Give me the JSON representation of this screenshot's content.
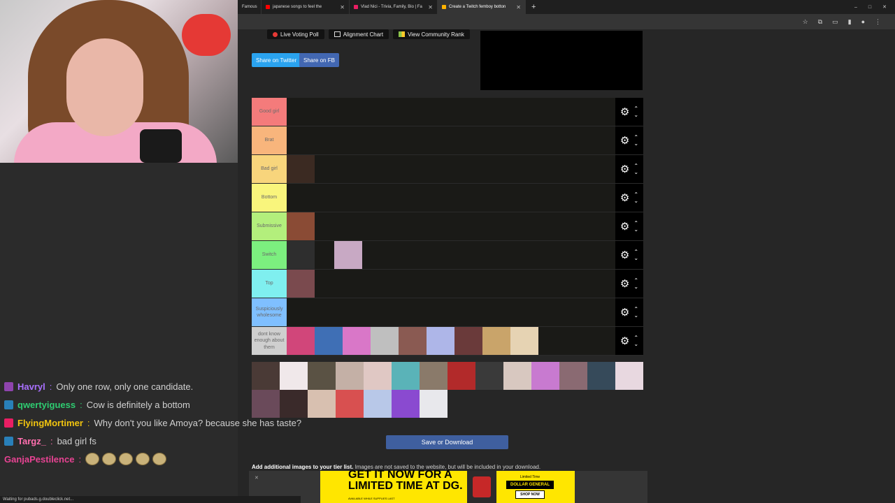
{
  "browser": {
    "tabs": [
      {
        "title": "Famous",
        "color": "#c62828",
        "active": false
      },
      {
        "title": "japanese songs to feel the",
        "color": "#ff0000",
        "active": false
      },
      {
        "title": "Vlad Nici - Trivia, Family, Bio | Fa",
        "color": "#e91e63",
        "active": false
      },
      {
        "title": "Create a Twitch femboy botton",
        "color": "#ffb300",
        "active": true
      }
    ],
    "new_tab": "+",
    "window_controls": [
      "–",
      "□",
      "✕"
    ]
  },
  "toolbar": {
    "live_voting": "Live Voting Poll",
    "alignment_chart": "Alignment Chart",
    "community_rank": "View Community Rank",
    "share_twitter": "Share on Twitter",
    "share_fb": "Share on FB"
  },
  "tiers": [
    {
      "label": "Good girl",
      "color": "#f47b7b",
      "items": []
    },
    {
      "label": "Brat",
      "color": "#f8b57c",
      "items": []
    },
    {
      "label": "Bad girl",
      "color": "#f8d57c",
      "items": [
        "#3b2a22"
      ]
    },
    {
      "label": "Bottom",
      "color": "#f9f57c",
      "items": []
    },
    {
      "label": "Submissive",
      "color": "#b3ef7c",
      "items": [
        "#8a4b35"
      ]
    },
    {
      "label": "Switch",
      "color": "#7cef7f",
      "items": [
        "#2e2e2e"
      ],
      "floating": "#c8a9c4"
    },
    {
      "label": "Top",
      "color": "#7fefef",
      "items": [
        "#7a4a4e"
      ]
    },
    {
      "label": "Suspiciously wholesome",
      "color": "#7fbfff",
      "items": []
    },
    {
      "label": "dont know enough about them",
      "color": "#cfcfcf",
      "items": [
        "#d1467a",
        "#3f6fb5",
        "#d977c8",
        "#bfbfbf",
        "#8a5a52",
        "#aeb6e8",
        "#6a3a3a",
        "#c9a46a",
        "#e6d3b3"
      ]
    }
  ],
  "pool": [
    "#4a3a36",
    "#f0e8ea",
    "#5a5244",
    "#c4b0a6",
    "#e0c8c4",
    "#5ab3b8",
    "#8a7a6a",
    "#b22a2a",
    "#3a3a3a",
    "#d8c8c0",
    "#c87ad0",
    "#8a6a72",
    "#364a5a",
    "#e8d8e0",
    "#6a4a5a",
    "#3a2a2a",
    "#d8c0b0",
    "#d85050",
    "#b8c8e8",
    "#8a4ad0",
    "#e8e8ec"
  ],
  "save_button": "Save or Download",
  "add_images": {
    "bold": "Add additional images to your tier list.",
    "rest": " Images are not saved to the website, but will be included in your download."
  },
  "ad": {
    "headline": "GET IT NOW FOR A LIMITED TIME AT DG.",
    "fine_print": "AVAILABLE WHILE SUPPLIES LAST",
    "limited": "Limited Time",
    "brand": "DOLLAR GENERAL",
    "shop": "SHOP NOW"
  },
  "chat": [
    {
      "user": "Havryl",
      "text": "Only one row, only one candidate.",
      "color": "#a970ff",
      "badge": "#8e44ad"
    },
    {
      "user": "qwertyiguess",
      "text": "Cow is definitely a bottom",
      "color": "#2ecc71",
      "badge": "#2980b9"
    },
    {
      "user": "FlyingMortimer",
      "text": "Why don't you like Amoya? because she has taste?",
      "color": "#f1c40f",
      "badge": "#e91e63"
    },
    {
      "user": "Targz_",
      "text": "bad girl fs",
      "color": "#ff6fae",
      "badge": "#2980b9"
    },
    {
      "user": "GanjaPestilence",
      "text": "",
      "color": "#e84393",
      "badge": "",
      "potatoes": 5
    }
  ],
  "status": "Waiting for pubads.g.doubleclick.net..."
}
